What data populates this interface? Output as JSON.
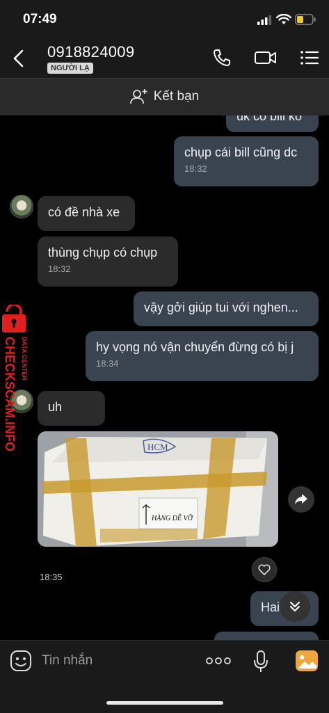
{
  "status_bar": {
    "time": "07:49"
  },
  "header": {
    "contact_name": "0918824009",
    "badge": "NGƯỜI LẠ"
  },
  "friend_bar": {
    "label": "Kết bạn"
  },
  "messages": {
    "m0": {
      "text": "uk có bill ko"
    },
    "m1": {
      "text": "chụp cái bill cũng dc",
      "time": "18:32"
    },
    "m2": {
      "text": "có đề nhà xe"
    },
    "m3": {
      "text": "thùng chụp có chụp",
      "time": "18:32"
    },
    "m4": {
      "text": "vậy gởi giúp tui với nghen..."
    },
    "m5": {
      "text": "hy vọng nó vận chuyển đừng có bị j",
      "time": "18:34"
    },
    "m6": {
      "text": "uh"
    },
    "photo": {
      "time": "18:35",
      "box_marking": "HCM",
      "label_text": "HÀNG DỄ VỠ"
    },
    "m7": {
      "text": "Hai"
    }
  },
  "watermark": {
    "top": "DATA CENTER",
    "main": "CHECKSCAM.INFO"
  },
  "input": {
    "placeholder": "Tin nhắn"
  },
  "colors": {
    "my_bubble": "#3a4451",
    "their_bubble": "#2b2b2b",
    "watermark": "#e0201e"
  }
}
